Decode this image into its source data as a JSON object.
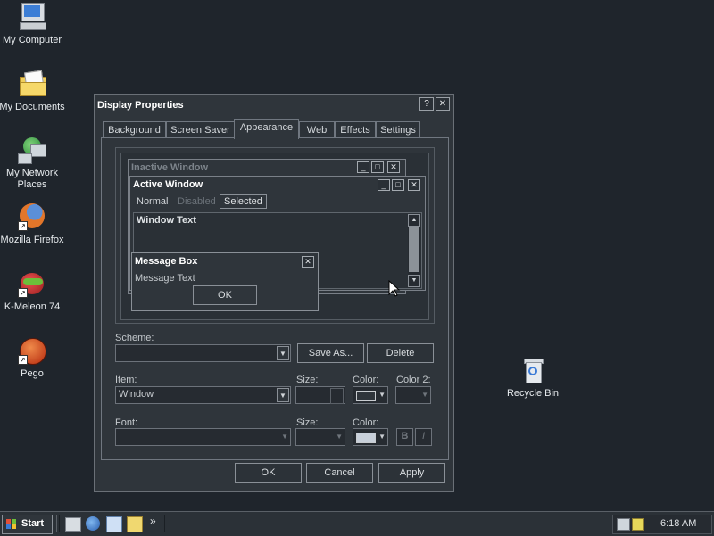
{
  "desktop": {
    "icons": [
      {
        "label": "My Computer",
        "icon": "computer-icon"
      },
      {
        "label": "My Documents",
        "icon": "folder-icon"
      },
      {
        "label": "My Network",
        "label2": "Places",
        "icon": "network-icon"
      },
      {
        "label": "Mozilla Firefox",
        "icon": "firefox-icon"
      },
      {
        "label": "K-Meleon 74",
        "icon": "kmeleon-icon"
      },
      {
        "label": "Pego",
        "icon": "pego-icon"
      },
      {
        "label": "Recycle Bin",
        "icon": "recycle-bin-icon"
      }
    ]
  },
  "dialog": {
    "title": "Display Properties",
    "help_glyph": "?",
    "close_glyph": "✕",
    "tabs": [
      "Background",
      "Screen Saver",
      "Appearance",
      "Web",
      "Effects",
      "Settings"
    ],
    "active_tab": "Appearance",
    "preview": {
      "inactive_title": "Inactive Window",
      "active_title": "Active Window",
      "menu_normal": "Normal",
      "menu_disabled": "Disabled",
      "menu_selected": "Selected",
      "window_text": "Window Text",
      "msgbox_title": "Message Box",
      "msgbox_text": "Message Text",
      "msgbox_ok": "OK"
    },
    "scheme": {
      "label": "Scheme:",
      "value": "",
      "save_as": "Save As...",
      "delete": "Delete"
    },
    "item": {
      "label": "Item:",
      "value": "Window",
      "size_label": "Size:",
      "color_label": "Color:",
      "color2_label": "Color 2:",
      "color_value": "#2f353b"
    },
    "font": {
      "label": "Font:",
      "size_label": "Size:",
      "color_label": "Color:",
      "color_value": "#c8d0da",
      "bold": "B",
      "italic": "I"
    },
    "buttons": {
      "ok": "OK",
      "cancel": "Cancel",
      "apply": "Apply"
    }
  },
  "taskbar": {
    "start_label": "Start",
    "more_glyph": "»",
    "clock": "6:18 AM"
  }
}
